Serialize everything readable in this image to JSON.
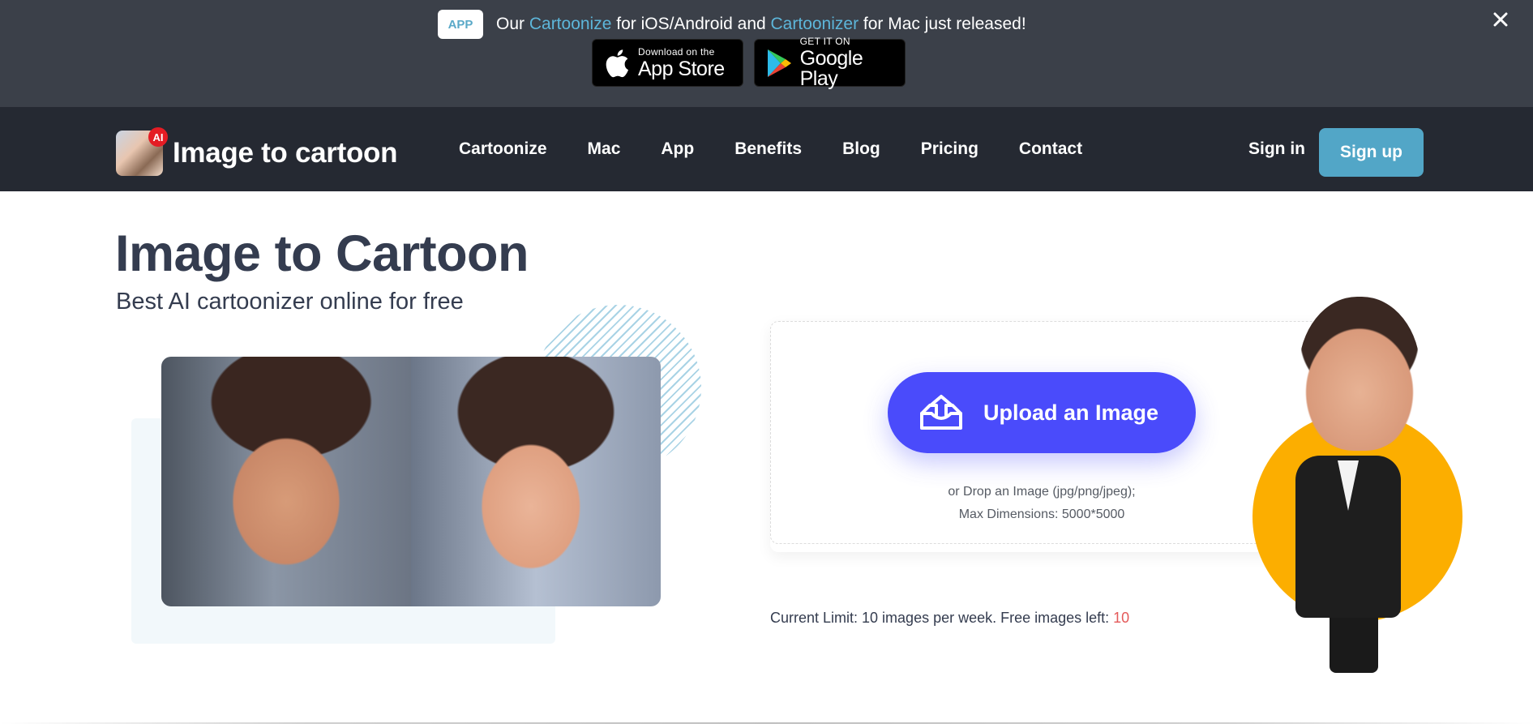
{
  "promo": {
    "badge": "APP",
    "text_prefix": "Our ",
    "link1": "Cartoonize",
    "text_mid": " for iOS/Android and ",
    "link2": "Cartoonizer",
    "text_suffix": " for Mac just released!",
    "app_store": {
      "small": "Download on the",
      "big": "App Store",
      "icon": "apple-icon"
    },
    "google_play": {
      "small": "GET IT ON",
      "big": "Google Play",
      "icon": "google-play-icon"
    },
    "close_icon": "close-icon"
  },
  "nav": {
    "logo_badge": "AI",
    "logo_text": "Image to cartoon",
    "links": [
      "Cartoonize",
      "Mac",
      "App",
      "Benefits",
      "Blog",
      "Pricing",
      "Contact"
    ],
    "sign_in": "Sign in",
    "sign_up": "Sign up"
  },
  "hero": {
    "title": "Image to Cartoon",
    "subtitle": "Best AI cartoonizer online for free"
  },
  "upload": {
    "button_label": "Upload an Image",
    "button_icon": "upload-tray-icon",
    "drop_hint_line1": "or Drop an Image (jpg/png/jpeg);",
    "drop_hint_line2": "Max Dimensions: 5000*5000"
  },
  "limit": {
    "text": "Current Limit: 10 images per week. Free images left: ",
    "remaining": "10"
  },
  "colors": {
    "banner_bg": "#3b4049",
    "nav_bg": "#252932",
    "accent_link": "#5db6da",
    "signup_bg": "#52a6c7",
    "upload_btn": "#4a4bfb",
    "title_text": "#343c4f",
    "remaining_count": "#e45a5a",
    "character_circle": "#fcae00"
  }
}
